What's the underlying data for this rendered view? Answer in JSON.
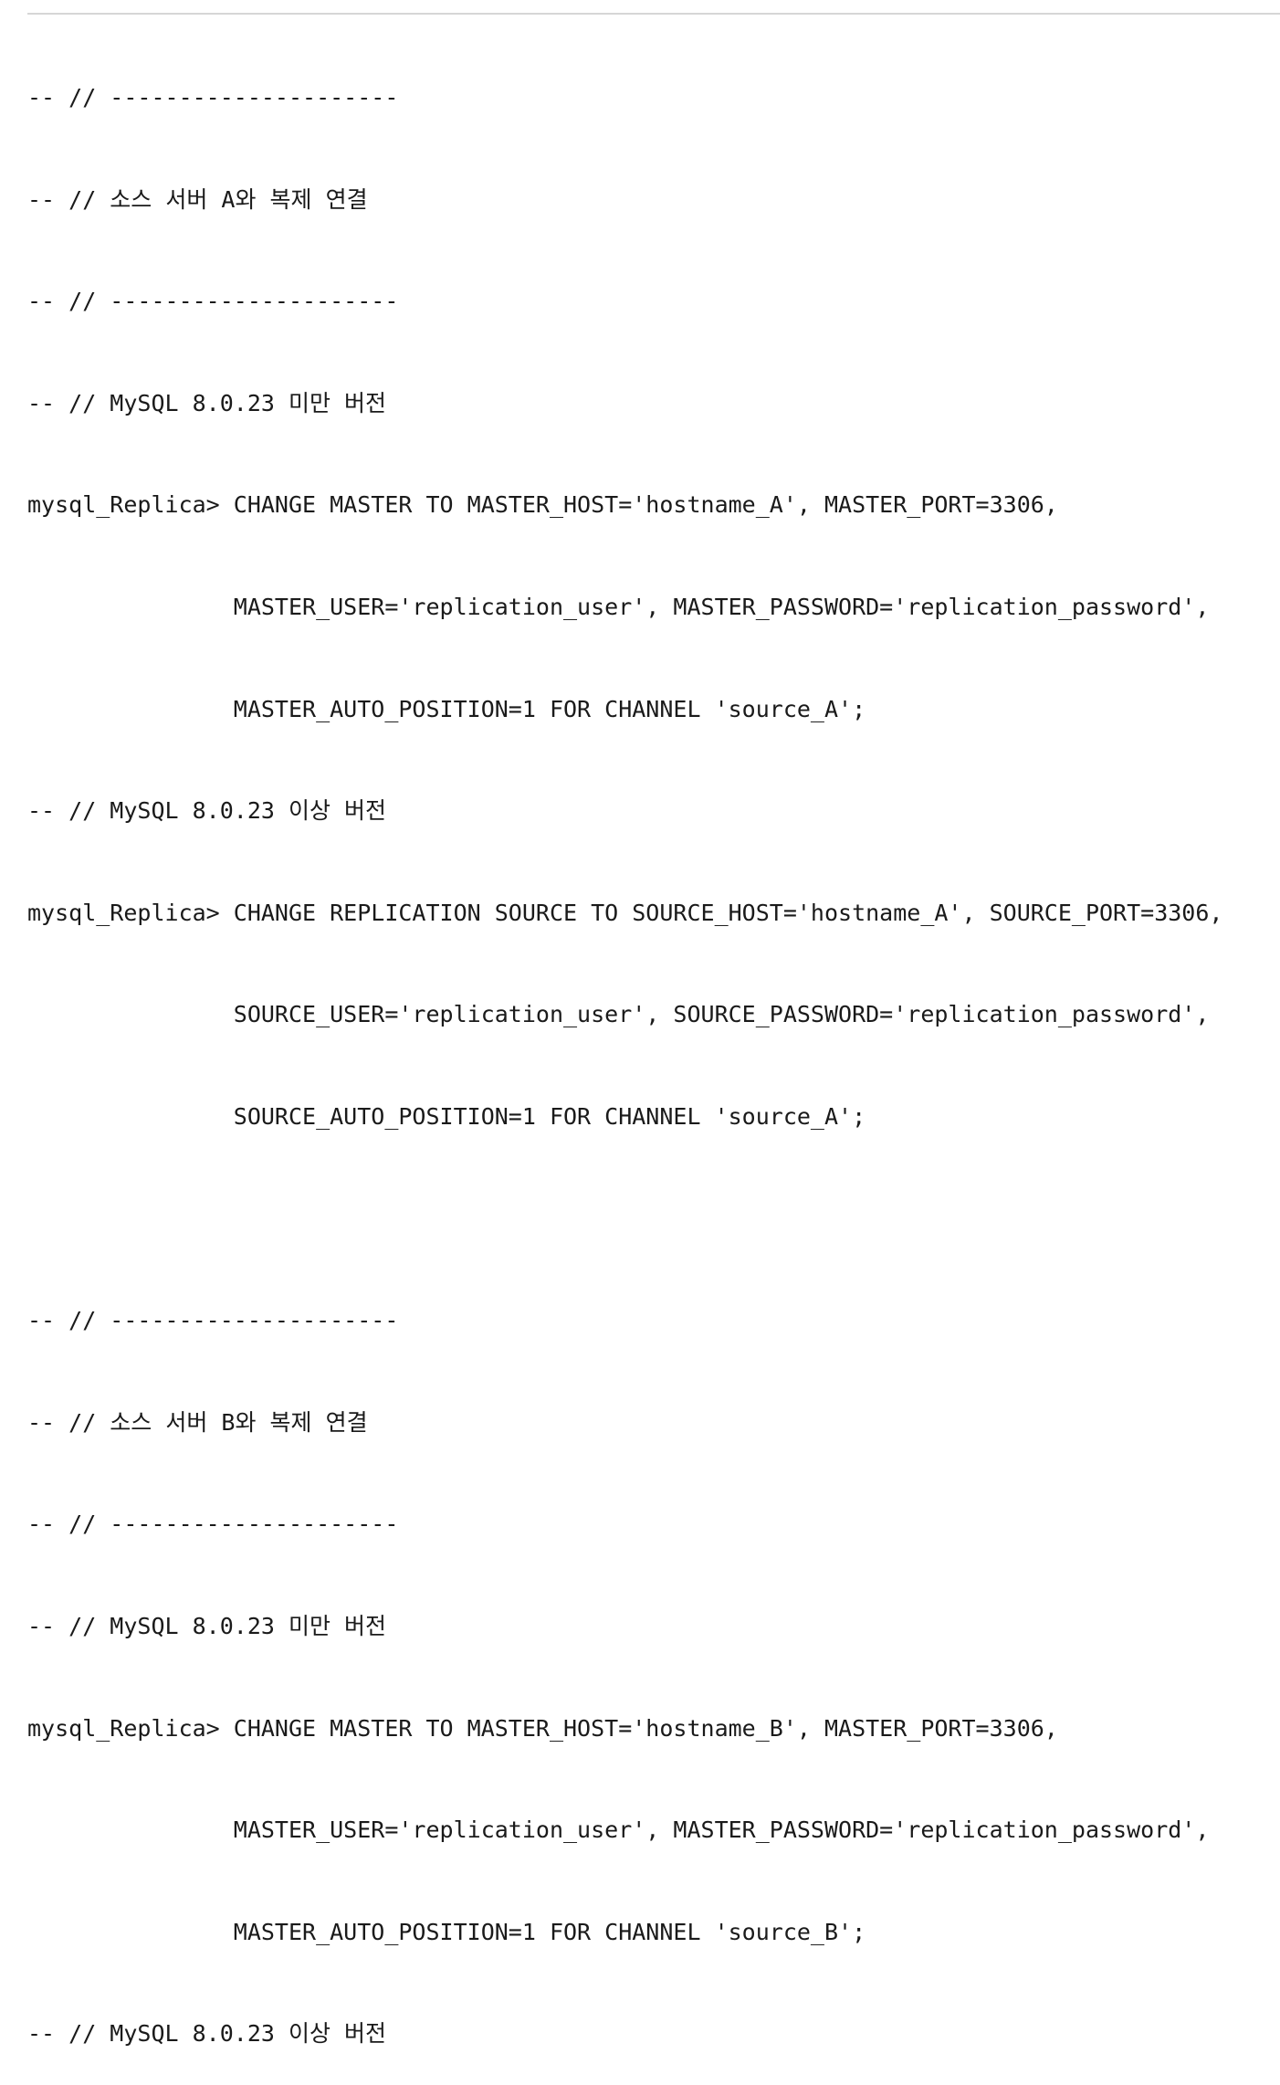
{
  "code_lines": [
    "-- // ---------------------",
    "-- // 소스 서버 A와 복제 연결",
    "-- // ---------------------",
    "-- // MySQL 8.0.23 미만 버전",
    "mysql_Replica> CHANGE MASTER TO MASTER_HOST='hostname_A', MASTER_PORT=3306,",
    "               MASTER_USER='replication_user', MASTER_PASSWORD='replication_password',",
    "               MASTER_AUTO_POSITION=1 FOR CHANNEL 'source_A';",
    "-- // MySQL 8.0.23 이상 버전",
    "mysql_Replica> CHANGE REPLICATION SOURCE TO SOURCE_HOST='hostname_A', SOURCE_PORT=3306,",
    "               SOURCE_USER='replication_user', SOURCE_PASSWORD='replication_password',",
    "               SOURCE_AUTO_POSITION=1 FOR CHANNEL 'source_A';",
    "",
    "-- // ---------------------",
    "-- // 소스 서버 B와 복제 연결",
    "-- // ---------------------",
    "-- // MySQL 8.0.23 미만 버전",
    "mysql_Replica> CHANGE MASTER TO MASTER_HOST='hostname_B', MASTER_PORT=3306,",
    "               MASTER_USER='replication_user', MASTER_PASSWORD='replication_password',",
    "               MASTER_AUTO_POSITION=1 FOR CHANNEL 'source_B';",
    "-- // MySQL 8.0.23 이상 버전"
  ]
}
